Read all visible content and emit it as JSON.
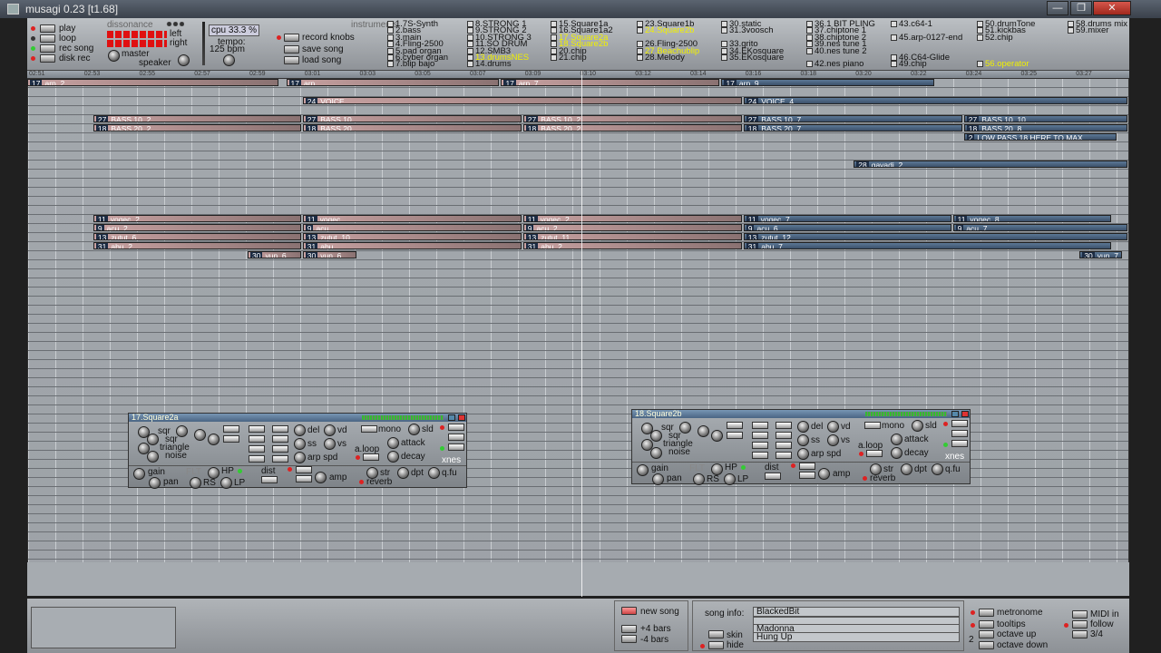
{
  "window": {
    "title": "musagi 0.23 [t1.68]",
    "min": "—",
    "max": "❐",
    "close": "✕"
  },
  "transport": {
    "play": "play",
    "loop": "loop",
    "rec_song": "rec song",
    "disk_rec": "disk rec",
    "dissonance": "dissonance",
    "left": "left",
    "right": "right",
    "master": "master",
    "speaker": "speaker",
    "cpu": "cpu 33.3 %",
    "tempo_label": "tempo:",
    "tempo": "125 bpm",
    "record_knobs": "record knobs",
    "save_song": "save song",
    "load_song": "load song",
    "instruments": "instruments"
  },
  "instruments": [
    [
      "1.7S-Synth",
      "2.bass",
      "3.main",
      "4.Fling-2500",
      "5.pad organ",
      "6.cyber organ",
      "7.blip bajo"
    ],
    [
      "8.STRONG 1",
      "9.STRONG 2",
      "10.STRONG 3",
      "11.SO DRUM",
      "12.SMB3",
      "13.drumsNES",
      "14.drums"
    ],
    [
      "15.Square1a",
      "16.Square1a2",
      "17.Square2a",
      "18.Square2b",
      "20.chip",
      "21.chip"
    ],
    [
      "23.Square1b",
      "24.Square2b",
      "",
      "26.Fling-2500",
      "27.Beachublip",
      "28.Melody"
    ],
    [
      "30.static",
      "31.3voosch",
      "",
      "33.grito",
      "34.EKosquare",
      "35.EKosquare"
    ],
    [
      "36.1 BIT PLING",
      "37.chiptone 1",
      "38.chiptone 2",
      "39.nes tune 1",
      "40.nes tune 2",
      "",
      "42.nes piano"
    ],
    [
      "43.c64-1",
      "",
      "45.arp-0127-end",
      "",
      "",
      "46.C64-Glide",
      "49.chip"
    ],
    [
      "50.drumTone",
      "51.kickbas",
      "52.chip",
      "",
      "",
      "",
      "56.operator"
    ],
    [
      "58.drums mix",
      "59.mixer"
    ]
  ],
  "instrument_highlight": [
    "17.Square2a",
    "18.Square2b",
    "24.Square2b",
    "13.drumsNES",
    "27.Beachublip",
    "56.operator"
  ],
  "timeline_ticks": [
    "02:51",
    "02:53",
    "02:55",
    "02:57",
    "02:59",
    "03:01",
    "03:03",
    "03:05",
    "03:07",
    "03:09",
    "03:10",
    "03:12",
    "03:14",
    "03:16",
    "03:18",
    "03:20",
    "03:22",
    "03:24",
    "03:25",
    "03:27"
  ],
  "tracks": [
    {
      "row": 0,
      "clips": [
        {
          "num": "17",
          "name": "arp_2",
          "s": 0,
          "e": 0.23,
          "old": true
        },
        {
          "num": "17",
          "name": "arp",
          "s": 0.235,
          "e": 0.43,
          "old": true
        },
        {
          "num": "17",
          "name": "arp_7",
          "s": 0.43,
          "e": 0.63,
          "old": true
        },
        {
          "num": "17",
          "name": "arp_9",
          "s": 0.63,
          "e": 0.825,
          "old": false
        }
      ]
    },
    {
      "row": 2,
      "clips": [
        {
          "num": "24",
          "name": "VOICE",
          "s": 0.25,
          "e": 0.65,
          "old": true
        },
        {
          "num": "24",
          "name": "VOICE_4",
          "s": 0.65,
          "e": 1,
          "old": false
        }
      ]
    },
    {
      "row": 4,
      "clips": [
        {
          "num": "27",
          "name": "BASS 10_2",
          "s": 0.06,
          "e": 0.25,
          "old": true
        },
        {
          "num": "27",
          "name": "BASS 10",
          "s": 0.25,
          "e": 0.45,
          "old": true
        },
        {
          "num": "27",
          "name": "BASS 10_2",
          "s": 0.45,
          "e": 0.65,
          "old": true
        },
        {
          "num": "27",
          "name": "BASS 10_7",
          "s": 0.65,
          "e": 0.85,
          "old": false
        },
        {
          "num": "27",
          "name": "BASS 10_10",
          "s": 0.85,
          "e": 1,
          "old": false
        }
      ]
    },
    {
      "row": 5,
      "clips": [
        {
          "num": "18",
          "name": "BASS 20_2",
          "s": 0.06,
          "e": 0.25,
          "old": true
        },
        {
          "num": "18",
          "name": "BASS 20",
          "s": 0.25,
          "e": 0.45,
          "old": true
        },
        {
          "num": "18",
          "name": "BASS 20_2",
          "s": 0.45,
          "e": 0.65,
          "old": true
        },
        {
          "num": "18",
          "name": "BASS 20_7",
          "s": 0.65,
          "e": 0.85,
          "old": false
        },
        {
          "num": "18",
          "name": "BASS 20_8",
          "s": 0.85,
          "e": 1,
          "old": false
        }
      ]
    },
    {
      "row": 6,
      "clips": [
        {
          "num": "2",
          "name": "LOW PASS 18 HERE TO MAX",
          "s": 0.85,
          "e": 0.99,
          "old": false
        }
      ]
    },
    {
      "row": 9,
      "clips": [
        {
          "num": "28",
          "name": "gavadi_2",
          "s": 0.75,
          "e": 1,
          "old": false
        }
      ]
    },
    {
      "row": 15,
      "clips": [
        {
          "num": "11",
          "name": "voqec_2",
          "s": 0.06,
          "e": 0.25,
          "old": true
        },
        {
          "num": "11",
          "name": "voqec",
          "s": 0.25,
          "e": 0.45,
          "old": true
        },
        {
          "num": "11",
          "name": "voqec_2",
          "s": 0.45,
          "e": 0.65,
          "old": true
        },
        {
          "num": "11",
          "name": "voqec_7",
          "s": 0.65,
          "e": 0.84,
          "old": false
        },
        {
          "num": "11",
          "name": "voqec_8",
          "s": 0.84,
          "e": 0.985,
          "old": false
        }
      ]
    },
    {
      "row": 16,
      "clips": [
        {
          "num": "9",
          "name": "acu_2",
          "s": 0.06,
          "e": 0.25,
          "old": true
        },
        {
          "num": "9",
          "name": "acu",
          "s": 0.25,
          "e": 0.45,
          "old": true
        },
        {
          "num": "9",
          "name": "acu_2",
          "s": 0.45,
          "e": 0.65,
          "old": true
        },
        {
          "num": "9",
          "name": "acu_6",
          "s": 0.65,
          "e": 0.84,
          "old": false
        },
        {
          "num": "9",
          "name": "acu_7",
          "s": 0.84,
          "e": 1,
          "old": false
        }
      ]
    },
    {
      "row": 17,
      "clips": [
        {
          "num": "13",
          "name": "zutut_6",
          "s": 0.06,
          "e": 0.25,
          "old": true
        },
        {
          "num": "13",
          "name": "zutut_10",
          "s": 0.25,
          "e": 0.45,
          "old": true
        },
        {
          "num": "13",
          "name": "zutut_11",
          "s": 0.45,
          "e": 0.65,
          "old": true
        },
        {
          "num": "13",
          "name": "zutut_12",
          "s": 0.65,
          "e": 1,
          "old": false
        }
      ]
    },
    {
      "row": 18,
      "clips": [
        {
          "num": "31",
          "name": "abu_2",
          "s": 0.06,
          "e": 0.25,
          "old": true
        },
        {
          "num": "31",
          "name": "abu",
          "s": 0.25,
          "e": 0.45,
          "old": true
        },
        {
          "num": "31",
          "name": "abu_2",
          "s": 0.45,
          "e": 0.65,
          "old": true
        },
        {
          "num": "31",
          "name": "abu_7",
          "s": 0.65,
          "e": 0.985,
          "old": false
        }
      ]
    },
    {
      "row": 19,
      "clips": [
        {
          "num": "30",
          "name": "vun_6",
          "s": 0.2,
          "e": 0.25,
          "old": true
        },
        {
          "num": "30",
          "name": "vun_6",
          "s": 0.25,
          "e": 0.3,
          "old": true
        },
        {
          "num": "30",
          "name": "vun_7",
          "s": 0.955,
          "e": 0.995,
          "old": false
        }
      ]
    }
  ],
  "synth1": {
    "title": "17.Square2a",
    "sqr": "sqr",
    "sqr2": "sqr",
    "triangle": "triangle",
    "noise": "noise",
    "del": "del",
    "vd": "vd",
    "ss": "ss",
    "vs": "vs",
    "arp_spd": "arp spd",
    "mono": "mono",
    "sld": "sld",
    "aloop": "a.loop",
    "attack": "attack",
    "decay": "decay",
    "xnes": "xnes",
    "gain": "gain",
    "pan": "pan",
    "flt": "FLT",
    "hp": "HP",
    "rs": "RS",
    "lp": "LP",
    "dist": "dist",
    "amp": "amp",
    "str": "str",
    "dpt": "dpt",
    "qfu": "q.fu",
    "reverb": "reverb"
  },
  "synth2": {
    "title": "18.Square2b"
  },
  "bottom": {
    "new_song": "new song",
    "plus4": "+4 bars",
    "minus4": "-4 bars",
    "skin": "skin",
    "hide": "hide",
    "song_info": "song info:",
    "title_val": "BlackedBit",
    "author_val": "",
    "author2": "Madonna",
    "comment": "Hung Up",
    "metronome": "metronome",
    "tooltips": "tooltips",
    "octave_up": "octave up",
    "octave_down": "octave down",
    "midi_in": "MIDI in",
    "follow": "follow",
    "meter": "3/4",
    "two": "2"
  }
}
